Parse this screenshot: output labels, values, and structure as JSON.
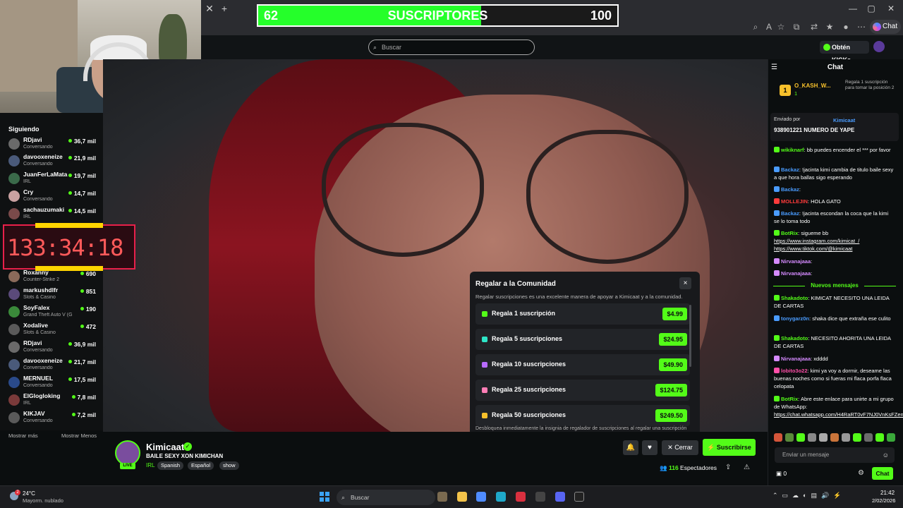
{
  "sub_goal": {
    "current": "62",
    "label": "SUSCRIPTORES",
    "goal": "100",
    "progress": 0.62
  },
  "header": {
    "search_placeholder": "Buscar",
    "get_kicks": "Obtén KICKs"
  },
  "browser": {
    "copilot": "Chat"
  },
  "sidebar": {
    "title": "Siguiendo",
    "channels": [
      {
        "name": "RDjavi",
        "category": "Conversando",
        "viewers": "36,7 mil"
      },
      {
        "name": "davooxeneize",
        "category": "Conversando",
        "viewers": "21,9 mil"
      },
      {
        "name": "JuanFerLaMata",
        "category": "IRL",
        "viewers": "19,7 mil"
      },
      {
        "name": "Cry",
        "category": "Conversando",
        "viewers": "14,7 mil"
      },
      {
        "name": "sachauzumaki",
        "category": "IRL",
        "viewers": "14,5 mil"
      },
      {
        "name": "Roxanny",
        "category": "Counter-Strike 2",
        "viewers": "690"
      },
      {
        "name": "markushdlfr",
        "category": "Slots & Casino",
        "viewers": "851"
      },
      {
        "name": "SoyFalex",
        "category": "Grand Theft Auto V (G...",
        "viewers": "190"
      },
      {
        "name": "Xodalive",
        "category": "Slots & Casino",
        "viewers": "472"
      },
      {
        "name": "RDjavi",
        "category": "Conversando",
        "viewers": "36,9 mil"
      },
      {
        "name": "davooxeneize",
        "category": "Conversando",
        "viewers": "21,7 mil"
      },
      {
        "name": "MERNUEL",
        "category": "Conversando",
        "viewers": "17,5 mil"
      },
      {
        "name": "ElGlogloking",
        "category": "IRL",
        "viewers": "7,8 mil"
      },
      {
        "name": "KIKJAV",
        "category": "Conversando",
        "viewers": "7,2 mil"
      }
    ],
    "show_more": "Mostrar más",
    "show_less": "Mostrar Menos"
  },
  "timer": "133:34:18",
  "gift_modal": {
    "title": "Regalar a la Comunidad",
    "close": "×",
    "description": "Regalar suscripciones es una excelente manera de apoyar a Kimicaat y a la comunidad.",
    "options": [
      {
        "label": "Regala 1 suscripción",
        "price": "$4.99",
        "color": "#53fc18"
      },
      {
        "label": "Regala 5 suscripciones",
        "price": "$24.95",
        "color": "#2ee6c8"
      },
      {
        "label": "Regala 10 suscripciones",
        "price": "$49.90",
        "color": "#b86bff"
      },
      {
        "label": "Regala 25 suscripciones",
        "price": "$124.75",
        "color": "#ff7eb6"
      },
      {
        "label": "Regala 50 suscripciones",
        "price": "$249.50",
        "color": "#f7c02b"
      }
    ],
    "footer": "Desbloquea inmediatamente la insignia de regalador de suscripciones al regalar una suscripción"
  },
  "stream": {
    "live": "LIVE",
    "name": "Kimicaat",
    "title": "BAILE SEXY XON KIMICHAN",
    "category": "IRL",
    "tags": [
      "Spanish",
      "Español",
      "show"
    ],
    "close_label": "Cerrar",
    "subscribe_label": "Suscribirse",
    "viewers_count": "116",
    "viewers_label": "Espectadores"
  },
  "chat": {
    "title": "Chat",
    "top_gifter": {
      "rank": "1",
      "name": "O_KASH_W...",
      "count": "1"
    },
    "gift_position": "Regala 1 suscripción para tomar la posición 2",
    "pinned": {
      "by": "Enviado por",
      "user": "Kimicaat",
      "message": "938901221 NUMERO DE YAPE"
    },
    "messages": [
      {
        "user": "wikiknarf",
        "color": "#53fc18",
        "text": "bb puedes encender el *** por favor"
      },
      {
        "user": "Backaz",
        "color": "#4a9cff",
        "text": "!jacinta kimi cambia de titulo baile sexy a que hora ballas sigo esperando"
      },
      {
        "user": "Backaz",
        "color": "#4a9cff",
        "text": ""
      },
      {
        "user": "MOLLEJIN",
        "color": "#ff3b3b",
        "text": "HOLA GATO"
      },
      {
        "user": "Backaz",
        "color": "#4a9cff",
        "text": "!jacinta escondan la coca que la kimi se lo toma todo"
      },
      {
        "user": "BotRix",
        "color": "#53fc18",
        "text": "siguemе bb",
        "links": [
          "https://www.instagram.com/kimicat_/",
          "https://www.tiktok.com/@kimicaat"
        ]
      },
      {
        "user": "Nirvanajaaa",
        "color": "#d58aff",
        "text": ""
      },
      {
        "user": "Nirvanajaaa",
        "color": "#d58aff",
        "text": ""
      },
      {
        "user": "Shakadoto",
        "color": "#53fc18",
        "text": "KIMICAT NECESITO UNA LEIDA DE CARTAS"
      },
      {
        "user": "tonygarz0n",
        "color": "#4a9cff",
        "text": "shaka dice que extraña ese culito"
      },
      {
        "user": "Shakadoto",
        "color": "#53fc18",
        "text": "NECESITO AHORITA UNA LEIDA DE CARTAS"
      },
      {
        "user": "Nirvanajaaa",
        "color": "#d58aff",
        "text": "xdddd"
      },
      {
        "user": "lobito3o22",
        "color": "#ff4fa8",
        "text": "kimi ya voy a dormir, deseame las buenas noches como si fueras mi flaca porfa flaca celopata"
      },
      {
        "user": "BotRix",
        "color": "#53fc18",
        "text": "Abre este enlace para unirte a mi grupo de WhatsApp:",
        "links": [
          "https://chat.whatsapp.com/H4RaRT0vF7NJ0VnKsFZen8"
        ]
      }
    ],
    "new_messages": "Nuevos mensajes",
    "input_placeholder": "Enviar un mensaje",
    "kicks_balance": "0",
    "send_label": "Chat"
  },
  "taskbar": {
    "temp": "24°C",
    "weather": "Mayorm. nublado",
    "weather_badge": "2",
    "search": "Buscar",
    "time": "21:42",
    "date": "2/02/2026"
  }
}
